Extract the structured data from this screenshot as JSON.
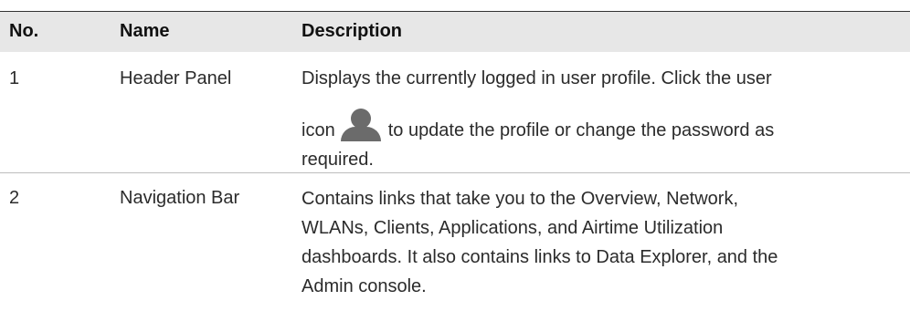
{
  "table": {
    "headers": {
      "no": "No.",
      "name": "Name",
      "description": "Description"
    },
    "rows": [
      {
        "no": "1",
        "name": "Header Panel",
        "description": {
          "line1": "Displays the currently logged in user profile. Click the user",
          "line2_before_icon": "icon",
          "icon": "user-icon",
          "line2_after_icon": "to update the profile or change the password as",
          "line3": "required."
        }
      },
      {
        "no": "2",
        "name": "Navigation Bar",
        "description": {
          "line1": "Contains links that take you to the Overview, Network,",
          "line2": "WLANs, Clients, Applications, and Airtime Utilization",
          "line3": "dashboards. It also contains links to Data Explorer, and the",
          "line4": "Admin console."
        }
      }
    ]
  },
  "colors": {
    "header_bg": "#e7e7e7",
    "icon": "#6b6b6b"
  }
}
